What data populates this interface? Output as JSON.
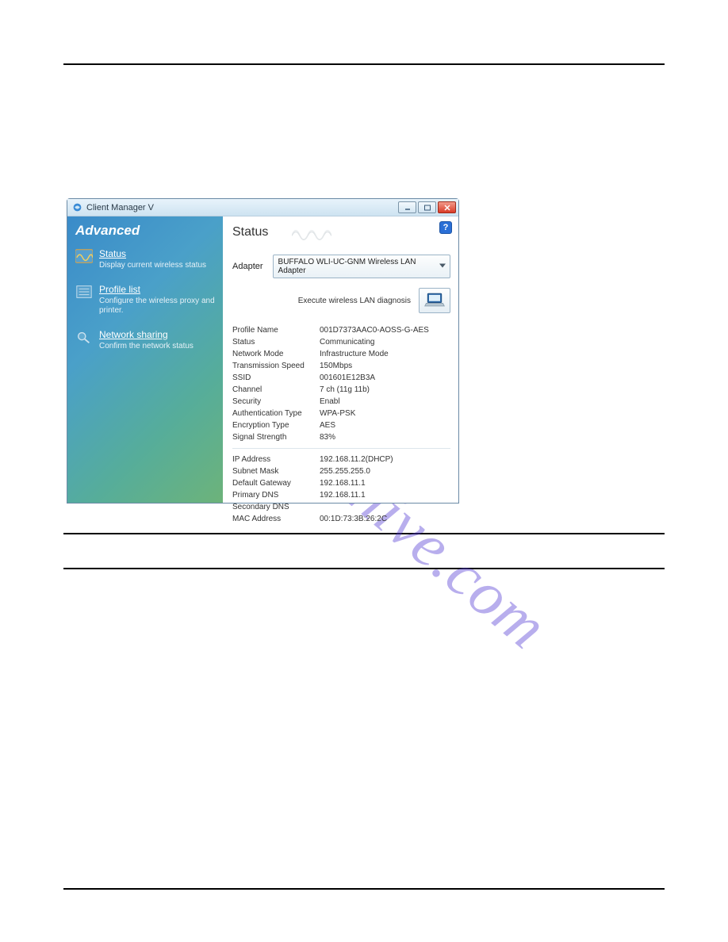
{
  "watermark_text": "manualshive.com",
  "window": {
    "title": "Client Manager V",
    "help_label": "?",
    "sidebar": {
      "heading": "Advanced",
      "items": [
        {
          "title": "Status",
          "desc": "Display current wireless status"
        },
        {
          "title": "Profile list",
          "desc": "Configure the wireless proxy and printer."
        },
        {
          "title": "Network sharing",
          "desc": "Confirm the network status"
        }
      ]
    },
    "content": {
      "heading": "Status",
      "adapter_label": "Adapter",
      "adapter_value": "BUFFALO WLI-UC-GNM Wireless LAN Adapter",
      "diagnosis_label": "Execute wireless LAN diagnosis",
      "group1": [
        {
          "k": "Profile Name",
          "v": "001D7373AAC0-AOSS-G-AES"
        },
        {
          "k": "Status",
          "v": "Communicating"
        },
        {
          "k": "Network Mode",
          "v": "Infrastructure Mode"
        },
        {
          "k": "Transmission Speed",
          "v": "150Mbps"
        },
        {
          "k": "SSID",
          "v": "001601E12B3A"
        },
        {
          "k": "Channel",
          "v": "7 ch (11g 11b)"
        },
        {
          "k": "Security",
          "v": "Enabl"
        },
        {
          "k": "Authentication Type",
          "v": "WPA-PSK"
        },
        {
          "k": "Encryption Type",
          "v": "AES"
        },
        {
          "k": "Signal Strength",
          "v": "83%"
        }
      ],
      "group2": [
        {
          "k": "IP Address",
          "v": "192.168.11.2(DHCP)"
        },
        {
          "k": "Subnet Mask",
          "v": "255.255.255.0"
        },
        {
          "k": "Default Gateway",
          "v": "192.168.11.1"
        },
        {
          "k": "Primary DNS",
          "v": "192.168.11.1"
        },
        {
          "k": "Secondary DNS",
          "v": ""
        },
        {
          "k": "MAC Address",
          "v": "00:1D:73:3B:26:2C"
        }
      ]
    }
  }
}
